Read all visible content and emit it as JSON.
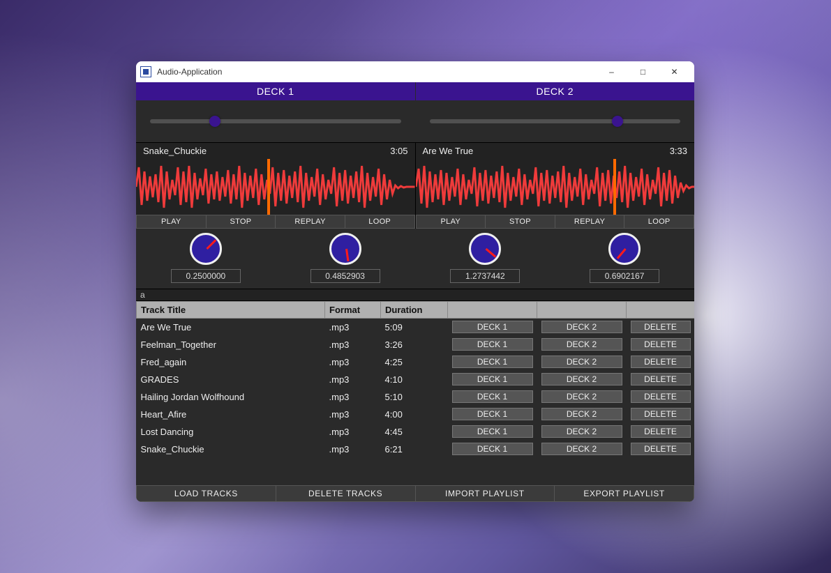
{
  "window": {
    "title": "Audio-Application"
  },
  "deck1": {
    "header": "DECK 1",
    "slider_pct": 26,
    "track_name": "Snake_Chuckie",
    "track_time": "3:05",
    "playhead_pct": 47,
    "transport": {
      "play": "PLAY",
      "stop": "STOP",
      "replay": "REPLAY",
      "loop": "LOOP"
    },
    "knob_a": {
      "value": "0.2500000",
      "angle": 225
    },
    "knob_b": {
      "value": "0.4852903",
      "angle": 352
    }
  },
  "deck2": {
    "header": "DECK 2",
    "slider_pct": 75,
    "track_name": "Are We True",
    "track_time": "3:33",
    "playhead_pct": 71,
    "transport": {
      "play": "PLAY",
      "stop": "STOP",
      "replay": "REPLAY",
      "loop": "LOOP"
    },
    "knob_a": {
      "value": "1.2737442",
      "angle": 310
    },
    "knob_b": {
      "value": "0.6902167",
      "angle": 40
    }
  },
  "search": "a",
  "playlist": {
    "headers": {
      "title": "Track Title",
      "format": "Format",
      "duration": "Duration",
      "a": "",
      "b": "",
      "c": ""
    },
    "row_buttons": {
      "deck1": "DECK 1",
      "deck2": "DECK 2",
      "delete": "DELETE"
    },
    "rows": [
      {
        "title": "Are We True",
        "format": ".mp3",
        "duration": "5:09"
      },
      {
        "title": "Feelman_Together",
        "format": ".mp3",
        "duration": "3:26"
      },
      {
        "title": "Fred_again",
        "format": ".mp3",
        "duration": "4:25"
      },
      {
        "title": "GRADES",
        "format": ".mp3",
        "duration": "4:10"
      },
      {
        "title": "Hailing Jordan Wolfhound",
        "format": ".mp3",
        "duration": "5:10"
      },
      {
        "title": "Heart_Afire",
        "format": ".mp3",
        "duration": "4:00"
      },
      {
        "title": "Lost Dancing",
        "format": ".mp3",
        "duration": "4:45"
      },
      {
        "title": "Snake_Chuckie",
        "format": ".mp3",
        "duration": "6:21"
      }
    ]
  },
  "bottom": {
    "load": "LOAD TRACKS",
    "delete": "DELETE TRACKS",
    "import": "IMPORT PLAYLIST",
    "export": "EXPORT PLAYLIST"
  }
}
